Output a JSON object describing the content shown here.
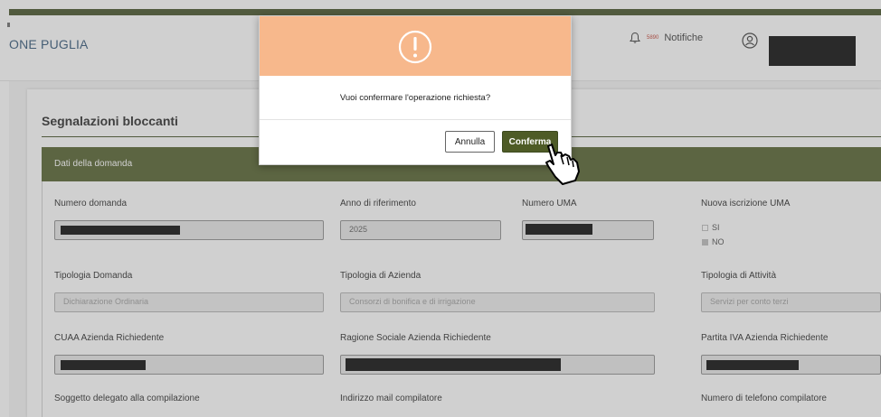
{
  "header": {
    "brand": "ONE PUGLIA",
    "notifications_badge": "5890",
    "notifications_label": "Notifiche"
  },
  "page": {
    "title": "Segnalazioni bloccanti",
    "section_title": "Dati della domanda"
  },
  "form": {
    "numero_domanda_label": "Numero domanda",
    "anno_label": "Anno di riferimento",
    "anno_value": "2025",
    "numero_uma_label": "Numero UMA",
    "nuova_iscrizione_label": "Nuova iscrizione UMA",
    "opt_si": "SI",
    "opt_no": "NO",
    "tipologia_domanda_label": "Tipologia Domanda",
    "tipologia_domanda_value": "Dichiarazione Ordinaria",
    "tipologia_azienda_label": "Tipologia di Azienda",
    "tipologia_azienda_value": "Consorzi di bonifica e di irrigazione",
    "tipologia_attivita_label": "Tipologia di Attività",
    "tipologia_attivita_value": "Servizi per conto terzi",
    "cuaa_label": "CUAA Azienda Richiedente",
    "ragione_sociale_label": "Ragione Sociale Azienda Richiedente",
    "partita_iva_label": "Partita IVA Azienda Richiedente",
    "soggetto_label": "Soggetto delegato alla compilazione",
    "indirizzo_mail_label": "Indirizzo mail compilatore",
    "telefono_label": "Numero di telefono compilatore"
  },
  "modal": {
    "message": "Vuoi confermare l'operazione richiesta?",
    "cancel_label": "Annulla",
    "confirm_label": "Conferma"
  },
  "colors": {
    "accent_green": "#4e5b26",
    "modal_header": "#f7b88c"
  },
  "icons": {
    "bell": "bell-icon",
    "user": "user-icon",
    "warning": "exclamation-icon",
    "cursor": "hand-pointer-icon"
  }
}
